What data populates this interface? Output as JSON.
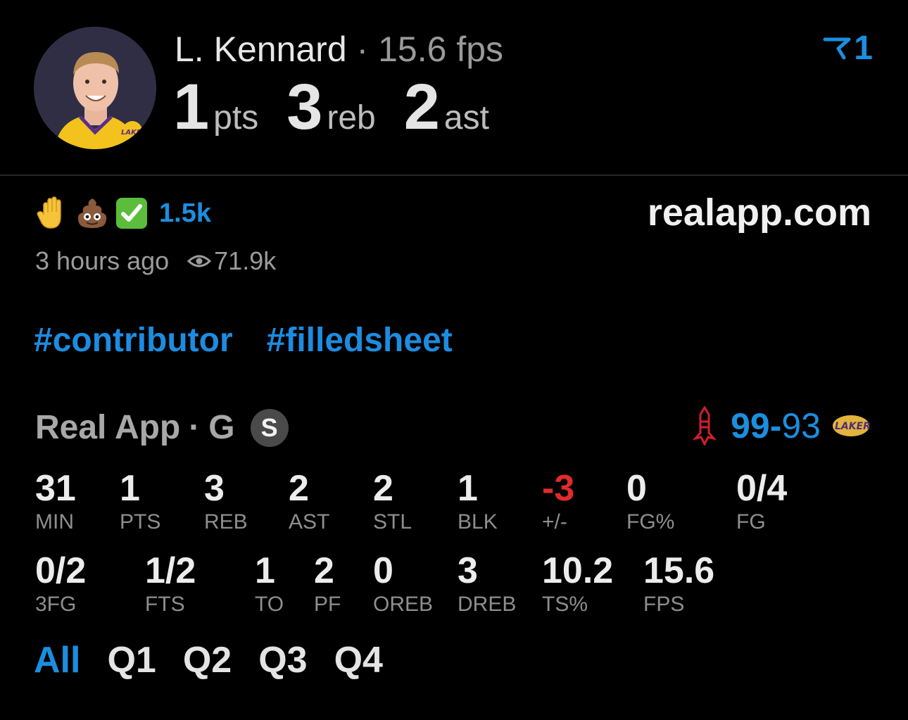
{
  "player": {
    "name": "L. Kennard",
    "separator": "·",
    "fps_text": "15.6 fps",
    "pts_value": "1",
    "pts_unit": "pts",
    "reb_value": "3",
    "reb_unit": "reb",
    "ast_value": "2",
    "ast_unit": "ast",
    "avatar_icon": "player-headshot-lakers"
  },
  "rank": {
    "icon": "rank-flag-icon",
    "value": "1"
  },
  "reactions": {
    "icons": [
      "raised-hand-emoji",
      "poop-emoji",
      "check-mark-emoji"
    ],
    "count": "1.5k"
  },
  "site": "realapp.com",
  "meta": {
    "time_ago": "3 hours ago",
    "views_icon": "eye-icon",
    "views": "71.9k"
  },
  "hashtags": [
    "#contributor",
    "#filledsheet"
  ],
  "game": {
    "source": "Real App",
    "separator": "·",
    "position": "G",
    "badge": "S",
    "home_team_icon": "rockets-logo",
    "away_team_icon": "lakers-logo",
    "score_home": "99",
    "score_dash": "-",
    "score_away": "93"
  },
  "stats_row1": [
    {
      "value": "31",
      "label": "MIN"
    },
    {
      "value": "1",
      "label": "PTS"
    },
    {
      "value": "3",
      "label": "REB"
    },
    {
      "value": "2",
      "label": "AST"
    },
    {
      "value": "2",
      "label": "STL"
    },
    {
      "value": "1",
      "label": "BLK"
    },
    {
      "value": "-3",
      "label": "+/-"
    },
    {
      "value": "0",
      "label": "FG%"
    },
    {
      "value": "0/4",
      "label": "FG"
    }
  ],
  "stats_row2": [
    {
      "value": "0/2",
      "label": "3FG"
    },
    {
      "value": "1/2",
      "label": "FTS"
    },
    {
      "value": "1",
      "label": "TO"
    },
    {
      "value": "2",
      "label": "PF"
    },
    {
      "value": "0",
      "label": "OREB"
    },
    {
      "value": "3",
      "label": "DREB"
    },
    {
      "value": "10.2",
      "label": "TS%"
    },
    {
      "value": "15.6",
      "label": "FPS"
    }
  ],
  "tabs": [
    {
      "label": "All",
      "active": true
    },
    {
      "label": "Q1",
      "active": false
    },
    {
      "label": "Q2",
      "active": false
    },
    {
      "label": "Q3",
      "active": false
    },
    {
      "label": "Q4",
      "active": false
    }
  ],
  "colors": {
    "accent_blue": "#1a8fe0",
    "negative_red": "#e02b2b",
    "background": "#000000"
  }
}
